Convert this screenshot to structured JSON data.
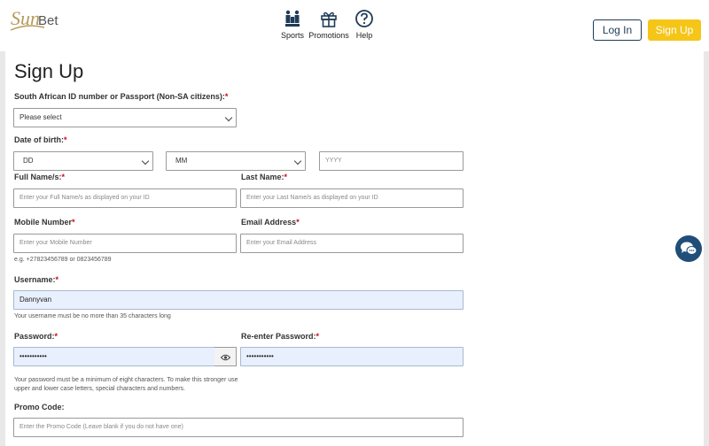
{
  "brand": {
    "logo_script": "Sun",
    "logo_word": "Bet"
  },
  "nav": [
    {
      "label": "Sports",
      "icon": "trophy-people-icon"
    },
    {
      "label": "Promotions",
      "icon": "gift-icon"
    },
    {
      "label": "Help",
      "icon": "question-circle-icon"
    }
  ],
  "header": {
    "login_label": "Log In",
    "signup_label": "Sign Up"
  },
  "colors": {
    "accent_yellow": "#f5c518",
    "navy": "#1f3b57",
    "required_red": "#d0021b",
    "autofill_blue": "#e8f0fd"
  },
  "form": {
    "title": "Sign Up",
    "id_label": "South African ID number or Passport (Non-SA citizens):",
    "id_select": "Please select",
    "dob_label": "Date of birth:",
    "dob_day": "DD",
    "dob_month": "MM",
    "dob_year_placeholder": "YYYY",
    "fullname_label": "Full Name/s:",
    "fullname_placeholder": "Enter your Full Name/s as displayed on your ID",
    "lastname_label": "Last Name:",
    "lastname_placeholder": "Enter your Last Name/s as displayed on your ID",
    "mobile_label": "Mobile Number",
    "mobile_placeholder": "Enter your Mobile Number",
    "mobile_hint": "e.g. +27823456789 or 0823456789",
    "email_label": "Email Address",
    "email_placeholder": "Enter your Email Address",
    "username_label": "Username:",
    "username_value": "Dannyvan",
    "username_hint": "Your username must be no more than 35 characters long",
    "password_label": "Password:",
    "password_value": "•••••••••••",
    "password_hint_1": "Your password must be a minimum of eight characters. To make this stronger use",
    "password_hint_2": "upper and lower case letters, special characters and numbers.",
    "repassword_label": "Re-enter Password:",
    "repassword_value": "•••••••••••",
    "promo_label": "Promo Code:",
    "promo_placeholder": "Enter the Promo Code (Leave blank if you do not have one)",
    "required_mark": "*"
  }
}
